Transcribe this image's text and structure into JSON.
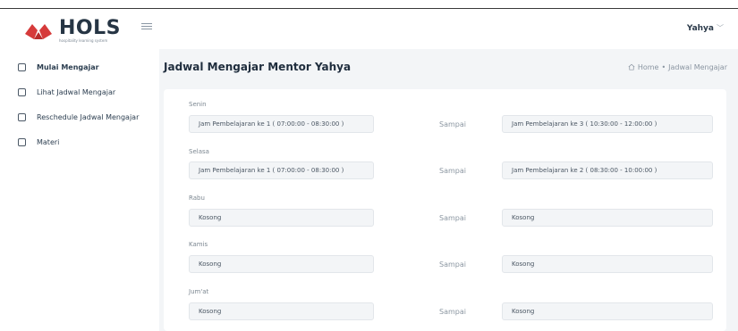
{
  "brand": {
    "name": "HOLS",
    "tagline": "hospitality learning system"
  },
  "header": {
    "user_name": "Yahya",
    "user_chevron": "﹀"
  },
  "sidebar": {
    "items": [
      {
        "label": "Mulai Mengajar"
      },
      {
        "label": "Lihat Jadwal Mengajar"
      },
      {
        "label": "Reschedule Jadwal Mengajar"
      },
      {
        "label": "Materi"
      }
    ]
  },
  "page": {
    "title": "Jadwal Mengajar Mentor Yahya",
    "breadcrumb": {
      "home": "Home",
      "separator": "•",
      "current": "Jadwal Mengajar"
    }
  },
  "schedule": {
    "between_label": "Sampai",
    "days": [
      {
        "day": "Senin",
        "from": "Jam Pembelajaran ke 1 ( 07:00:00 - 08:30:00 )",
        "to": "Jam Pembelajaran ke 3 ( 10:30:00 - 12:00:00 )"
      },
      {
        "day": "Selasa",
        "from": "Jam Pembelajaran ke 1 ( 07:00:00 - 08:30:00 )",
        "to": "Jam Pembelajaran ke 2 ( 08:30:00 - 10:00:00 )"
      },
      {
        "day": "Rabu",
        "from": "Kosong",
        "to": "Kosong"
      },
      {
        "day": "Kamis",
        "from": "Kosong",
        "to": "Kosong"
      },
      {
        "day": "Jum'at",
        "from": "Kosong",
        "to": "Kosong"
      }
    ]
  },
  "colors": {
    "logo_red": "#d63a3a",
    "text_dark": "#1f2d3d",
    "main_bg": "#f3f5f7"
  }
}
